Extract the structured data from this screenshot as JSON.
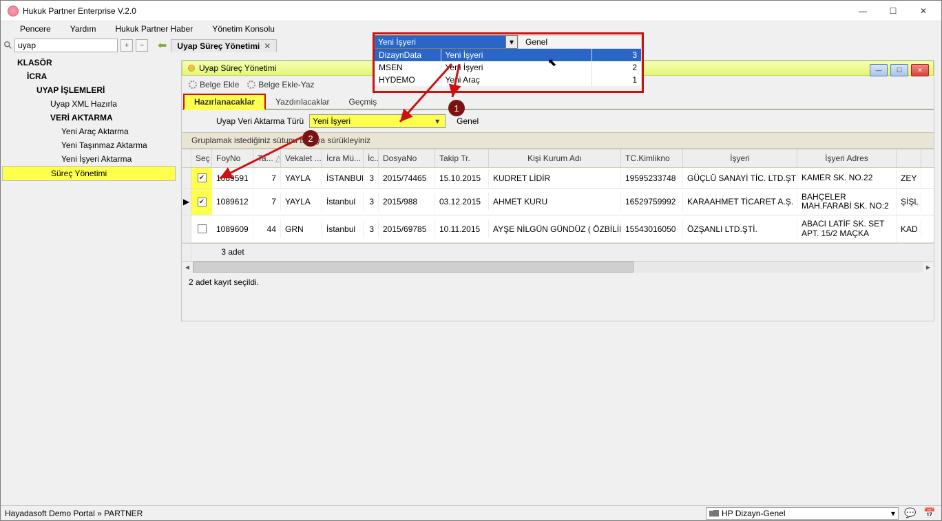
{
  "window": {
    "title": "Hukuk Partner Enterprise V.2.0"
  },
  "menu": {
    "items": [
      "Pencere",
      "Yardım",
      "Hukuk Partner Haber",
      "Yönetim Konsolu"
    ]
  },
  "toolbar": {
    "search_value": "uyap",
    "doc_tab": "Uyap Süreç Yönetimi"
  },
  "tree": {
    "klasor": "KLASÖR",
    "icra": "İCRA",
    "uyap_islemleri": "UYAP İŞLEMLERİ",
    "uyap_xml": "Uyap XML Hazırla",
    "veri_aktarma": "VERİ AKTARMA",
    "yeni_arac": "Yeni Araç Aktarma",
    "yeni_tasinmaz": "Yeni Taşınmaz Aktarma",
    "yeni_isyeri": "Yeni İşyeri Aktarma",
    "surec": "Süreç Yönetimi"
  },
  "inner": {
    "title": "Uyap Süreç Yönetimi",
    "belge_ekle": "Belge Ekle",
    "belge_ekle_yaz": "Belge Ekle-Yaz",
    "tabs": {
      "hazirlanacaklar": "Hazırlanacaklar",
      "yazdirilacaklar": "Yazdırılacaklar",
      "gecmis": "Geçmiş"
    },
    "filter_label": "Uyap Veri Aktarma Türü",
    "filter_value": "Yeni İşyeri",
    "filter_side": "Genel",
    "group_hint": "Gruplamak istediğiniz sütunu buraya sürükleyiniz",
    "columns": {
      "sec": "Seç",
      "foy": "FoyNo",
      "ta": "Ta...",
      "vek": "Vekalet ...",
      "icra": "İcra Mü...",
      "ic": "İc...",
      "dosya": "DosyaNo",
      "takip": "Takip Tr.",
      "kisi": "Kişi Kurum Adı",
      "tc": "TC.Kimlikno",
      "isyeri": "İşyeri",
      "adres": "İşyeri Adres"
    },
    "rows": [
      {
        "checked": true,
        "mark": "",
        "foy": "1089591",
        "ta": "7",
        "vek": "YAYLA",
        "icra": "İSTANBUL",
        "ic": "3",
        "dosya": "2015/74465",
        "takip": "15.10.2015",
        "kisi": "KUDRET LİDİR",
        "tc": "19595233748",
        "isyeri": "GÜÇLÜ SANAYİ TİC. LTD.ŞTİ.",
        "adres": "KAMER SK. NO.22",
        "last": "ZEY"
      },
      {
        "checked": true,
        "mark": "▶",
        "foy": "1089612",
        "ta": "7",
        "vek": "YAYLA",
        "icra": "İstanbul",
        "ic": "3",
        "dosya": "2015/988",
        "takip": "03.12.2015",
        "kisi": "AHMET KURU",
        "tc": "16529759992",
        "isyeri": "KARAAHMET TİCARET A.Ş.",
        "adres": "BAHÇELER MAH.FARABİ SK. NO:2",
        "last": "ŞİŞL"
      },
      {
        "checked": false,
        "mark": "",
        "foy": "1089609",
        "ta": "44",
        "vek": "GRN",
        "icra": "İstanbul",
        "ic": "3",
        "dosya": "2015/69785",
        "takip": "10.11.2015",
        "kisi": "AYŞE NİLGÜN GÜNDÜZ ( ÖZBİLİR )",
        "tc": "15543016050",
        "isyeri": "ÖZŞANLI LTD.ŞTİ.",
        "adres": "ABACI LATİF SK. SET APT. 15/2  MAÇKA",
        "last": "KAD"
      }
    ],
    "footer_count": "3 adet",
    "status": "2 adet kayıt seçildi."
  },
  "overlay": {
    "sel": "Yeni İşyeri",
    "side": "Genel",
    "rows": [
      {
        "c1": "DizaynData",
        "c2": "Yeni İşyeri",
        "c3": "3",
        "sel": true
      },
      {
        "c1": "MSEN",
        "c2": "Yeni İşyeri",
        "c3": "2",
        "sel": false
      },
      {
        "c1": "HYDEMO",
        "c2": "Yeni Araç",
        "c3": "1",
        "sel": false
      }
    ]
  },
  "anno": {
    "n1": "1",
    "n2": "2"
  },
  "statusbar": {
    "left": "Hayadasoft Demo Portal » PARTNER",
    "combo": "HP Dizayn-Genel"
  }
}
